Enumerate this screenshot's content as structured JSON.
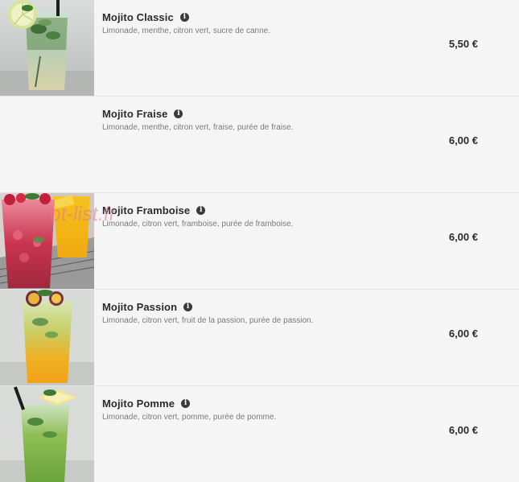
{
  "menu": {
    "items": [
      {
        "name": "Mojito Classic",
        "description": "Limonade, menthe, citron vert, sucre de canne.",
        "price": "5,50 €",
        "photo": "mojito-classic-photo"
      },
      {
        "name": "Mojito Fraise",
        "description": "Limonade, menthe, citron vert, fraise, purée de fraise.",
        "price": "6,00 €",
        "photo": null
      },
      {
        "name": "Mojito Framboise",
        "description": "Limonade, citron vert, framboise, purée de framboise.",
        "price": "6,00 €",
        "photo": "mojito-framboise-photo"
      },
      {
        "name": "Mojito Passion",
        "description": "Limonade, citron vert, fruit de la passion, purée de passion.",
        "price": "6,00 €",
        "photo": "mojito-passion-photo"
      },
      {
        "name": "Mojito Pomme",
        "description": "Limonade, citron vert, pomme, purée de pomme.",
        "price": "6,00 €",
        "photo": "mojito-pomme-photo"
      }
    ]
  },
  "watermark": {
    "text": "ot-list.fr"
  },
  "icons": {
    "info": "info-icon"
  }
}
